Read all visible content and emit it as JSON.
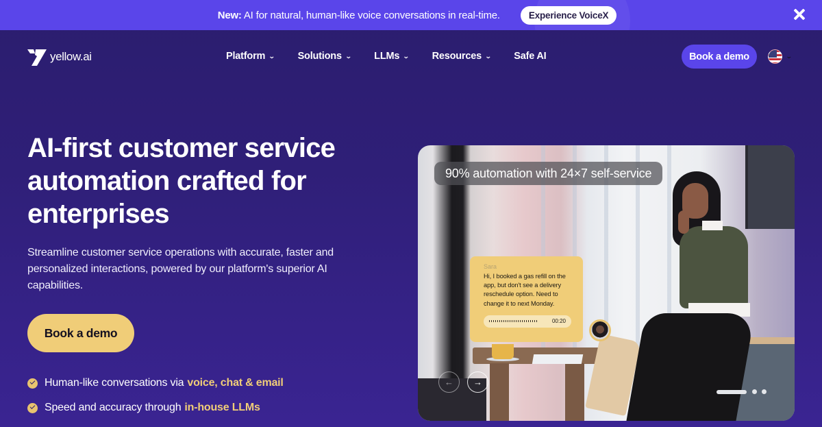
{
  "announcement": {
    "prefix": "New:",
    "text": "AI for natural, human-like voice conversations in real-time.",
    "button_label": "Experience VoiceX",
    "close_icon": "close-icon"
  },
  "nav": {
    "logo_text": "yellow.ai",
    "items": [
      {
        "label": "Platform",
        "has_dropdown": true
      },
      {
        "label": "Solutions",
        "has_dropdown": true
      },
      {
        "label": "LLMs",
        "has_dropdown": true
      },
      {
        "label": "Resources",
        "has_dropdown": true
      },
      {
        "label": "Safe AI",
        "has_dropdown": false
      }
    ],
    "cta_label": "Book a demo",
    "language_icon": "us-flag-icon"
  },
  "hero": {
    "title": "AI-first customer service automation crafted for enterprises",
    "subtitle": "Streamline customer service operations with accurate, faster and personalized interactions, powered by our platform's superior AI capabilities.",
    "cta_label": "Book a demo",
    "features": [
      {
        "text": "Human-like conversations via",
        "highlight": "voice, chat & email"
      },
      {
        "text": "Speed and accuracy through",
        "highlight": "in-house LLMs"
      }
    ]
  },
  "media": {
    "badge": "90% automation with 24×7 self-service",
    "chat": {
      "name": "Sara",
      "message": "Hi, I booked a gas refill on the app, but don't see a delivery reschedule option. Need to change it to next Monday.",
      "audio_duration": "00:20"
    },
    "prev_icon": "←",
    "next_icon": "→",
    "slides_total": 3,
    "slide_active": 1
  },
  "colors": {
    "accent": "#5a45ea",
    "highlight": "#f0cd78",
    "background": "#2b1d6e"
  }
}
